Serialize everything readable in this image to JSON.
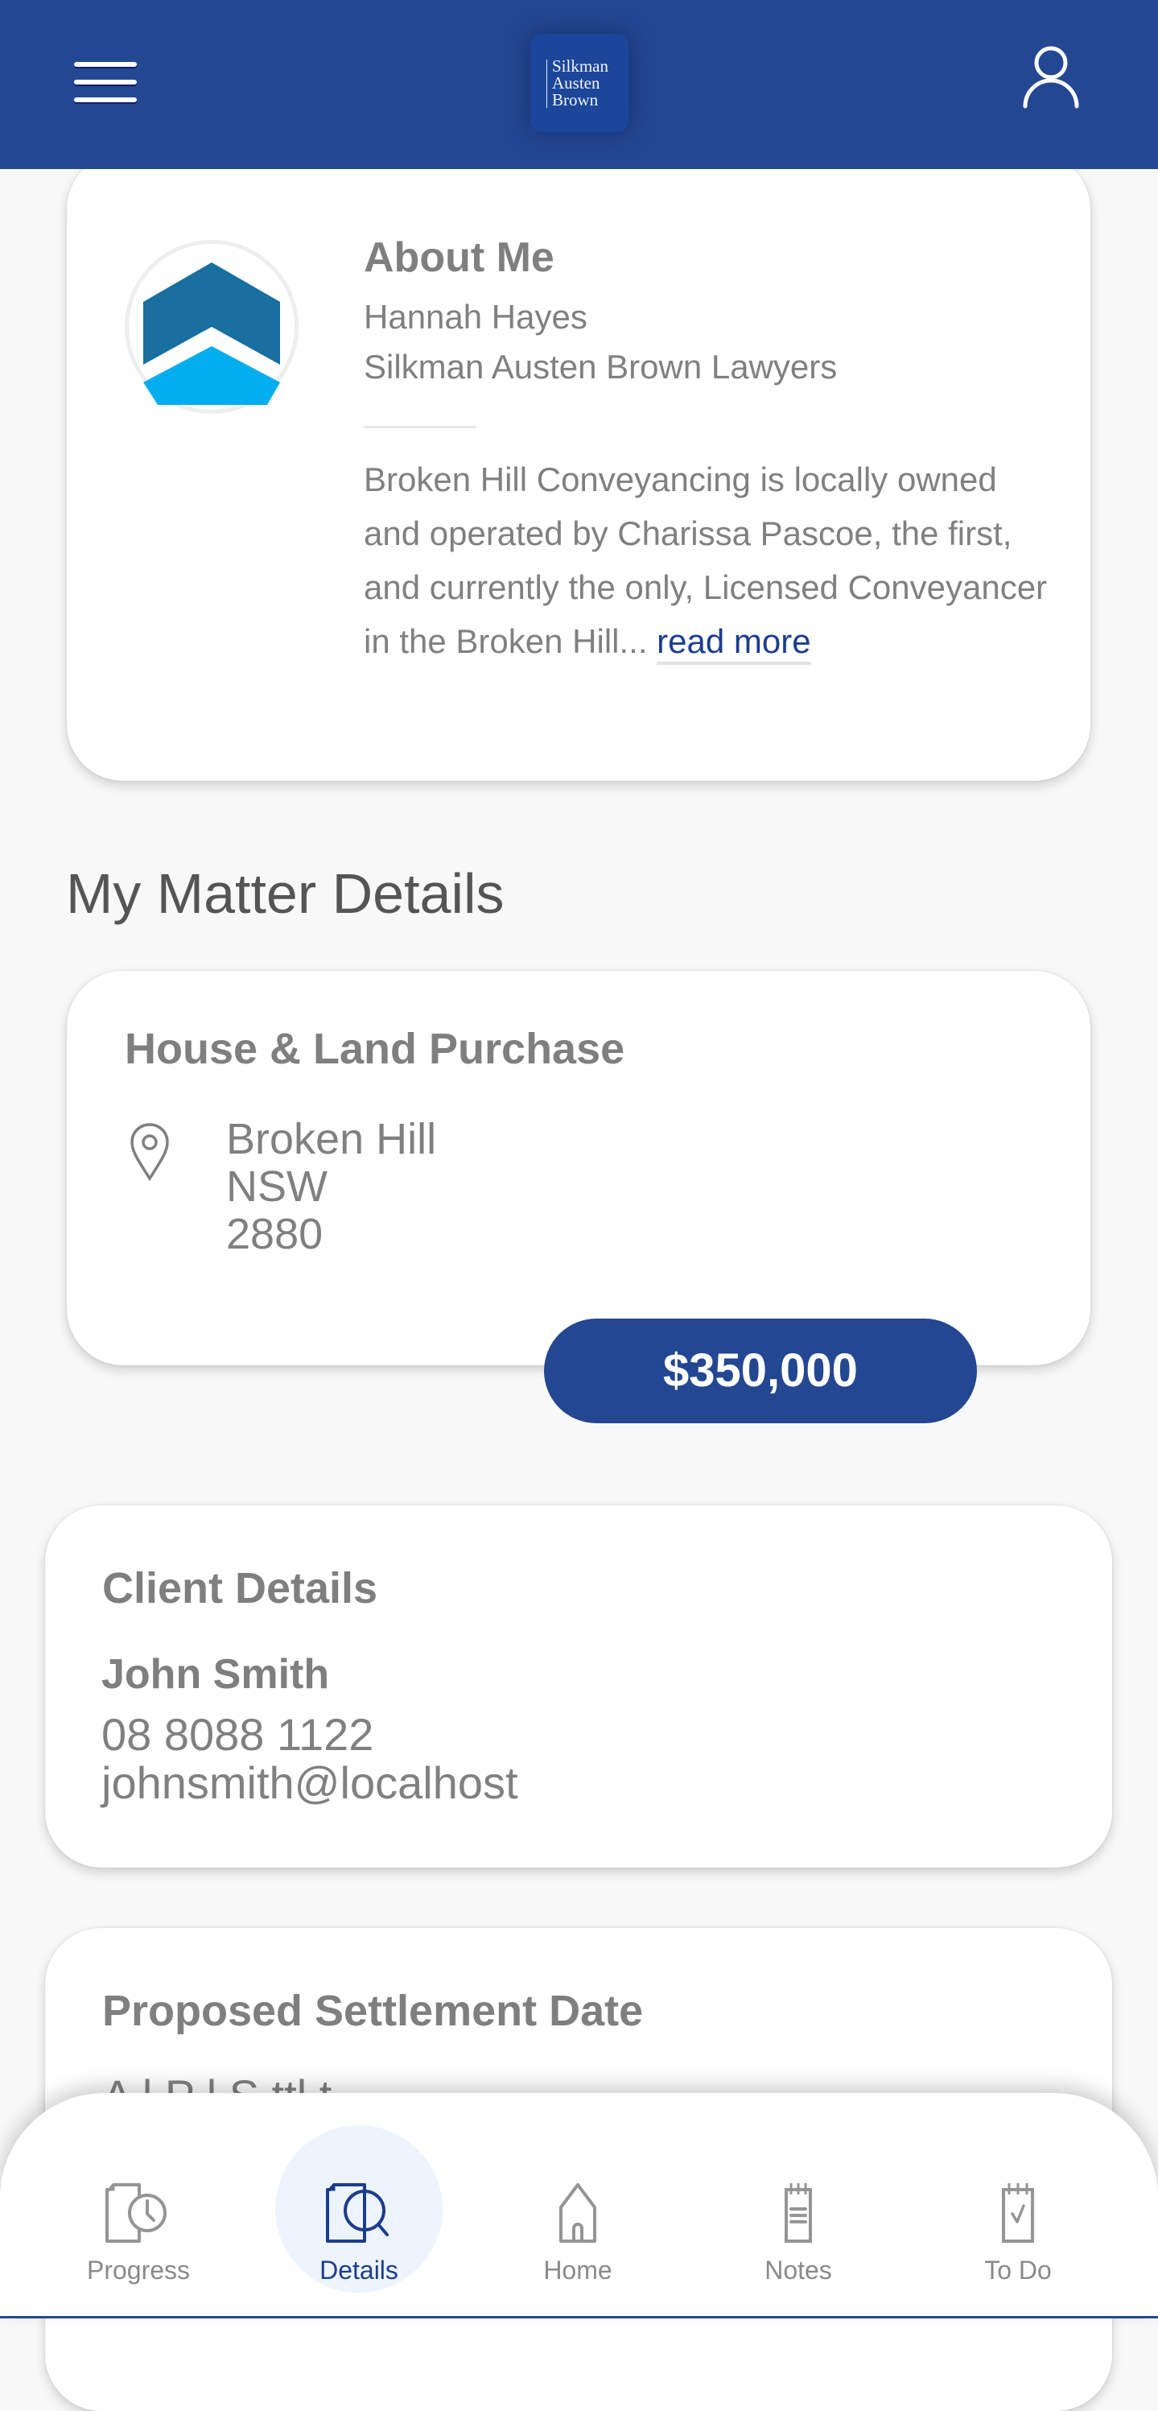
{
  "header": {
    "menu_icon": "hamburger-menu-icon",
    "logo_lines": [
      "Silkman",
      "Austen",
      "Brown"
    ],
    "profile_icon": "user-profile-icon",
    "background_color": "#244792"
  },
  "about": {
    "title": "About Me",
    "name": "Hannah Hayes",
    "firm": "Silkman Austen Brown Lawyers",
    "bio": "Broken Hill Conveyancing is locally owned and operated by Charissa Pascoe, the first, and currently the only, Licensed Conveyancer in the Broken Hill... ",
    "read_more_label": "read more",
    "avatar_icon": "company-logo-chevrons"
  },
  "matter": {
    "section_title": "My Matter Details",
    "type": "House & Land Purchase",
    "location_icon": "map-pin-icon",
    "address": {
      "suburb": "Broken Hill",
      "state": "NSW",
      "postcode": "2880"
    },
    "price": "$350,000"
  },
  "client": {
    "title": "Client Details",
    "name": "John Smith",
    "phone": "08 8088 1122",
    "email": "johnsmith@localhost"
  },
  "settlement": {
    "title": "Proposed Settlement Date",
    "partial_text": "A          l            P          l S ttl          t"
  },
  "nav": {
    "active": "Details",
    "items": [
      {
        "label": "Progress",
        "icon": "document-clock-icon"
      },
      {
        "label": "Details",
        "icon": "document-search-icon"
      },
      {
        "label": "Home",
        "icon": "house-icon"
      },
      {
        "label": "Notes",
        "icon": "notepad-icon"
      },
      {
        "label": "To Do",
        "icon": "checklist-icon"
      }
    ]
  },
  "colors": {
    "primary": "#244792",
    "link": "#1c3d8e",
    "text_gray": "#808080",
    "active_nav_bg": "#eef4fd",
    "logo_dark": "#186fa0",
    "logo_light": "#02aeed"
  }
}
